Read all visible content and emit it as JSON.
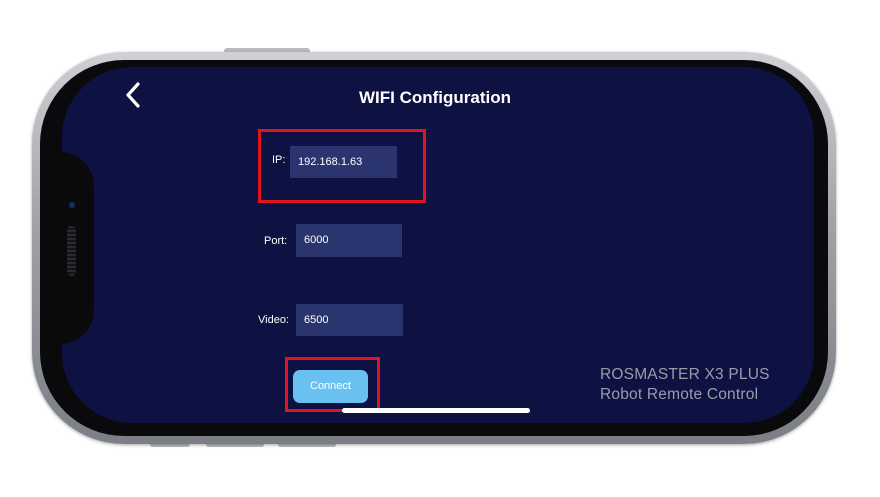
{
  "header": {
    "title": "WIFI Configuration"
  },
  "form": {
    "ip_label": "IP:",
    "ip_value": "192.168.1.63",
    "port_label": "Port:",
    "port_value": "6000",
    "video_label": "Video:",
    "video_value": "6500"
  },
  "actions": {
    "connect_label": "Connect"
  },
  "branding": {
    "line1": "ROSMASTER X3 PLUS",
    "line2": "Robot Remote Control"
  },
  "colors": {
    "screen_bg": "#0e1242",
    "input_bg": "#2a3570",
    "connect_bg": "#6ac1f1",
    "highlight": "#e2141f"
  },
  "icons": {
    "back": "chevron-left-icon"
  }
}
